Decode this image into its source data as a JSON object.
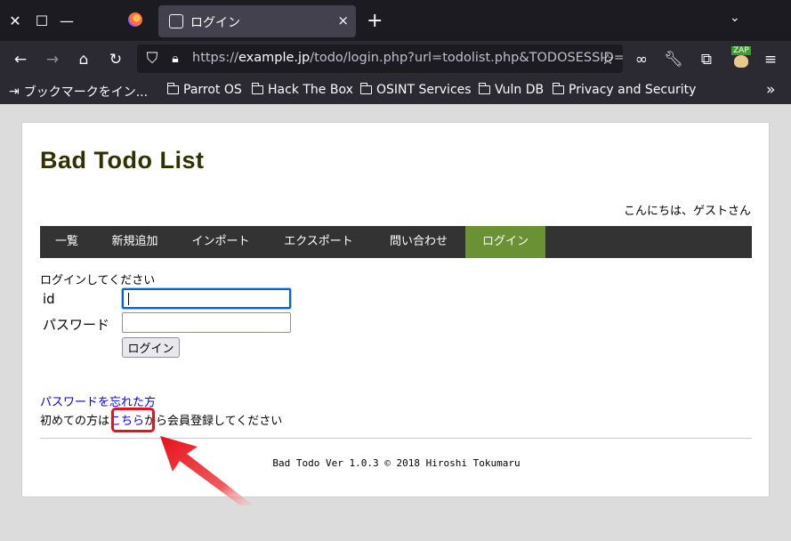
{
  "browser": {
    "tab": {
      "title": "ログイン",
      "close": "×"
    },
    "url": {
      "scheme": "https://",
      "host": "example.jp",
      "path": "/todo/login.php?url=todolist.php&TODOSESSID="
    },
    "window_controls": {
      "close": "✕",
      "maximize": "☐",
      "minimize": "—"
    },
    "new_tab": "+",
    "tab_list": "⌄",
    "zap_label": "ZAP",
    "bookmarks": [
      {
        "label": "ブックマークをイン..."
      },
      {
        "label": "Parrot OS"
      },
      {
        "label": "Hack The Box"
      },
      {
        "label": "OSINT Services"
      },
      {
        "label": "Vuln DB"
      },
      {
        "label": "Privacy and Security"
      }
    ],
    "bookmarks_more": "»"
  },
  "page": {
    "app_title": "Bad Todo List",
    "greeting": "こんにちは、ゲストさん",
    "menu": [
      {
        "label": "一覧"
      },
      {
        "label": "新規追加"
      },
      {
        "label": "インポート"
      },
      {
        "label": "エクスポート"
      },
      {
        "label": "問い合わせ"
      },
      {
        "label": "ログイン",
        "active": true
      }
    ],
    "prompt": "ログインしてください",
    "form": {
      "id_label": "id",
      "id_value": "",
      "password_label": "パスワード",
      "password_value": "",
      "submit_label": "ログイン"
    },
    "forgot_link": "パスワードを忘れた方",
    "signup": {
      "prefix": "初めての方は",
      "link": "こちら",
      "suffix": "から会員登録してください"
    },
    "footer": "Bad Todo Ver 1.0.3 © 2018 Hiroshi Tokumaru"
  },
  "colors": {
    "menu_bg": "#333333",
    "menu_active": "#6a9234",
    "link": "#0000ee",
    "highlight": "#e8101a",
    "title": "#303000"
  }
}
